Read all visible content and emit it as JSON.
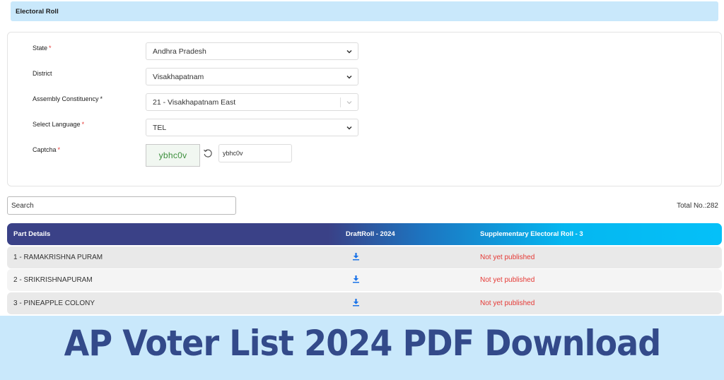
{
  "header": {
    "title": "Electoral Roll"
  },
  "form": {
    "fields": [
      {
        "label": "State",
        "required": "*",
        "value": "Andhra Pradesh"
      },
      {
        "label": "District",
        "required": "",
        "value": "Visakhapatnam"
      },
      {
        "label": "Assembly Constituency",
        "required": "*",
        "value": "21 - Visakhapatnam East"
      },
      {
        "label": "Select Language",
        "required": "*",
        "value": "TEL"
      }
    ],
    "captcha": {
      "label": "Captcha",
      "required": "*",
      "image_text": "ybhc0v",
      "input_value": "ybhc0v"
    }
  },
  "search": {
    "placeholder": "Search"
  },
  "total": "Total No.:282",
  "table": {
    "headers": [
      "Part Details",
      "DraftRoll - 2024",
      "Supplementary Electoral Roll - 3"
    ],
    "rows": [
      {
        "part": "1 - RAMAKRISHNA PURAM",
        "draft": "download-icon",
        "supplementary": "Not yet published"
      },
      {
        "part": "2 - SRIKRISHNAPURAM",
        "draft": "download-icon",
        "supplementary": "Not yet published"
      },
      {
        "part": "3 - PINEAPPLE COLONY",
        "draft": "download-icon",
        "supplementary": "Not yet published"
      }
    ]
  },
  "banner": {
    "text": "AP Voter List 2024 PDF Download"
  },
  "colors": {
    "header_bg": "#c9e8fb",
    "table_header_start": "#3a4187",
    "table_header_end": "#05c0f8",
    "status_red": "#e53935",
    "download_blue": "#1a73e8",
    "banner_text": "#334a8a"
  }
}
